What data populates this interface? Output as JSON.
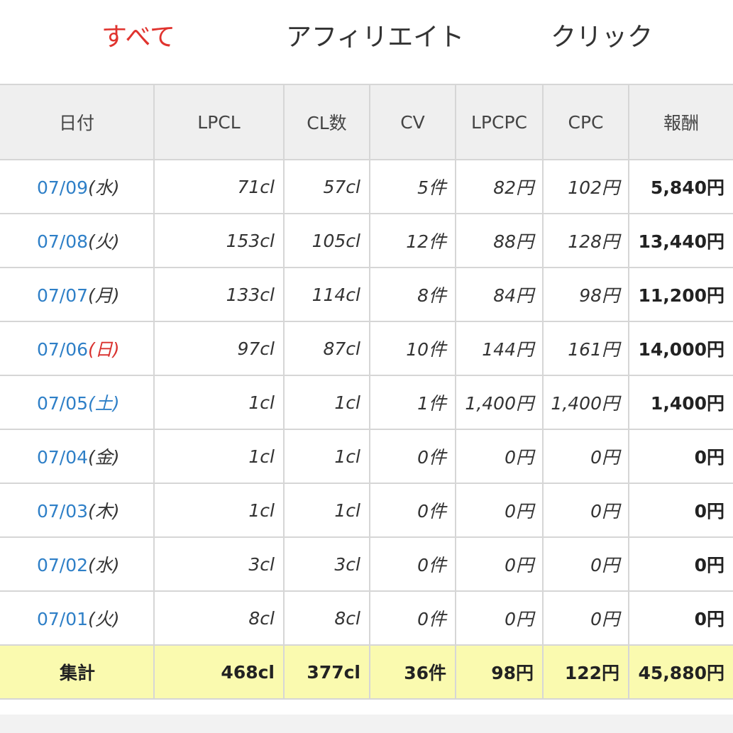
{
  "tabs": [
    {
      "label": "すべて",
      "active": true
    },
    {
      "label": "アフィリエイト",
      "active": false
    },
    {
      "label": "クリック",
      "active": false
    }
  ],
  "table": {
    "headers": [
      "日付",
      "LPCL",
      "CL数",
      "CV",
      "LPCPC",
      "CPC",
      "報酬"
    ],
    "rows": [
      {
        "date": "07/09",
        "dow": "(水)",
        "lpcl": "71cl",
        "cl": "57cl",
        "cv": "5件",
        "lpcpc": "82円",
        "cpc": "102円",
        "reward": "5,840円"
      },
      {
        "date": "07/08",
        "dow": "(火)",
        "lpcl": "153cl",
        "cl": "105cl",
        "cv": "12件",
        "lpcpc": "88円",
        "cpc": "128円",
        "reward": "13,440円"
      },
      {
        "date": "07/07",
        "dow": "(月)",
        "lpcl": "133cl",
        "cl": "114cl",
        "cv": "8件",
        "lpcpc": "84円",
        "cpc": "98円",
        "reward": "11,200円"
      },
      {
        "date": "07/06",
        "dow": "(日)",
        "lpcl": "97cl",
        "cl": "87cl",
        "cv": "10件",
        "lpcpc": "144円",
        "cpc": "161円",
        "reward": "14,000円"
      },
      {
        "date": "07/05",
        "dow": "(土)",
        "lpcl": "1cl",
        "cl": "1cl",
        "cv": "1件",
        "lpcpc": "1,400円",
        "cpc": "1,400円",
        "reward": "1,400円"
      },
      {
        "date": "07/04",
        "dow": "(金)",
        "lpcl": "1cl",
        "cl": "1cl",
        "cv": "0件",
        "lpcpc": "0円",
        "cpc": "0円",
        "reward": "0円"
      },
      {
        "date": "07/03",
        "dow": "(木)",
        "lpcl": "1cl",
        "cl": "1cl",
        "cv": "0件",
        "lpcpc": "0円",
        "cpc": "0円",
        "reward": "0円"
      },
      {
        "date": "07/02",
        "dow": "(水)",
        "lpcl": "3cl",
        "cl": "3cl",
        "cv": "0件",
        "lpcpc": "0円",
        "cpc": "0円",
        "reward": "0円"
      },
      {
        "date": "07/01",
        "dow": "(火)",
        "lpcl": "8cl",
        "cl": "8cl",
        "cv": "0件",
        "lpcpc": "0円",
        "cpc": "0円",
        "reward": "0円"
      }
    ],
    "total": {
      "label": "集計",
      "lpcl": "468cl",
      "cl": "377cl",
      "cv": "36件",
      "lpcpc": "98円",
      "cpc": "122円",
      "reward": "45,880円"
    }
  },
  "colors": {
    "active_tab": "#e0332e",
    "link": "#2e7fc7",
    "sunday": "#d9312e",
    "saturday": "#2e7fc7",
    "total_row_bg": "#fafaaf",
    "header_bg": "#efefef",
    "border": "#d6d6d6"
  }
}
